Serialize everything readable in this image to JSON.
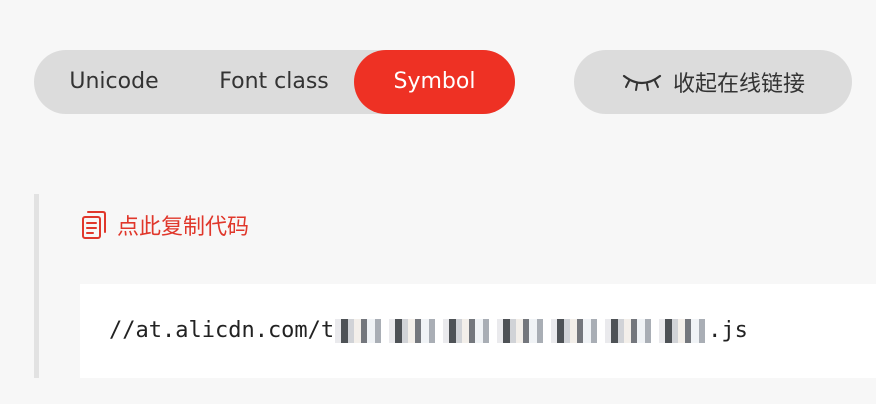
{
  "tabs": [
    {
      "label": "Unicode",
      "active": false
    },
    {
      "label": "Font class",
      "active": false
    },
    {
      "label": "Symbol",
      "active": true
    }
  ],
  "collapse_button": {
    "icon": "closed-eye-icon",
    "label": "收起在线链接"
  },
  "copy_link": {
    "icon": "copy-icon",
    "label": "点此复制代码"
  },
  "code": {
    "prefix": "//at.alicdn.com/t",
    "suffix": ".js"
  },
  "colors": {
    "accent": "#ee3124",
    "link": "#e0372b",
    "pill_bg": "#dcdcdc",
    "page_bg": "#f7f7f7"
  }
}
